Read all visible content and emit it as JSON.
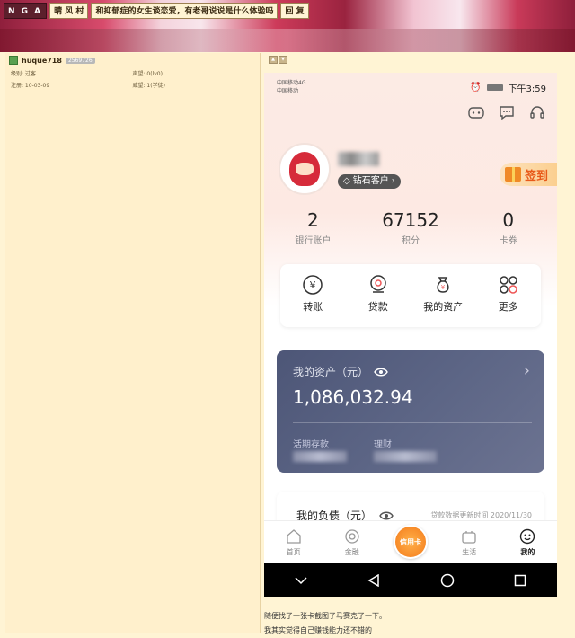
{
  "nav": {
    "logo": "N G A",
    "forum": "晴 风 村",
    "thread_title": "和抑郁症的女生谈恋爱，有老哥说说是什么体验吗",
    "reply": "回 复"
  },
  "user": {
    "name": "huque718",
    "uid_badge": "2569726",
    "level_label": "级别: 过客",
    "reputation_label": "声望: 0(lv0)",
    "reg_label": "注册: 10-03-09",
    "prestige_label": "威望: 1(学徒)"
  },
  "phone": {
    "status": {
      "carrier_line1": "中国移动4G",
      "carrier_line2": "中国移动",
      "time": "下午3:59"
    },
    "tier": "钻石客户",
    "signin": "签到",
    "stats": [
      {
        "value": "2",
        "label": "银行账户"
      },
      {
        "value": "67152",
        "label": "积分"
      },
      {
        "value": "0",
        "label": "卡券"
      }
    ],
    "quick_actions": [
      {
        "label": "转账",
        "icon": "transfer-icon"
      },
      {
        "label": "贷款",
        "icon": "loan-icon"
      },
      {
        "label": "我的资产",
        "icon": "money-bag-icon"
      },
      {
        "label": "更多",
        "icon": "more-grid-icon"
      }
    ],
    "assets": {
      "title": "我的资产（元）",
      "total": "1,086,032.94",
      "sub1": "活期存款",
      "sub2": "理财"
    },
    "debt": {
      "title": "我的负债（元）",
      "note": "贷款数据更新时间 2020/11/30"
    },
    "tabs": [
      {
        "label": "首页"
      },
      {
        "label": "金融"
      },
      {
        "label": "信用卡"
      },
      {
        "label": "生活"
      },
      {
        "label": "我的"
      }
    ]
  },
  "post": {
    "line1": "随便找了一张卡截图了马赛克了一下。",
    "line2": "我其实觉得自己赚钱能力还不错的"
  },
  "colors": {
    "page_bg": "#fff4d4",
    "asset_card": "#4d5677",
    "accent_orange": "#f47a1a"
  }
}
